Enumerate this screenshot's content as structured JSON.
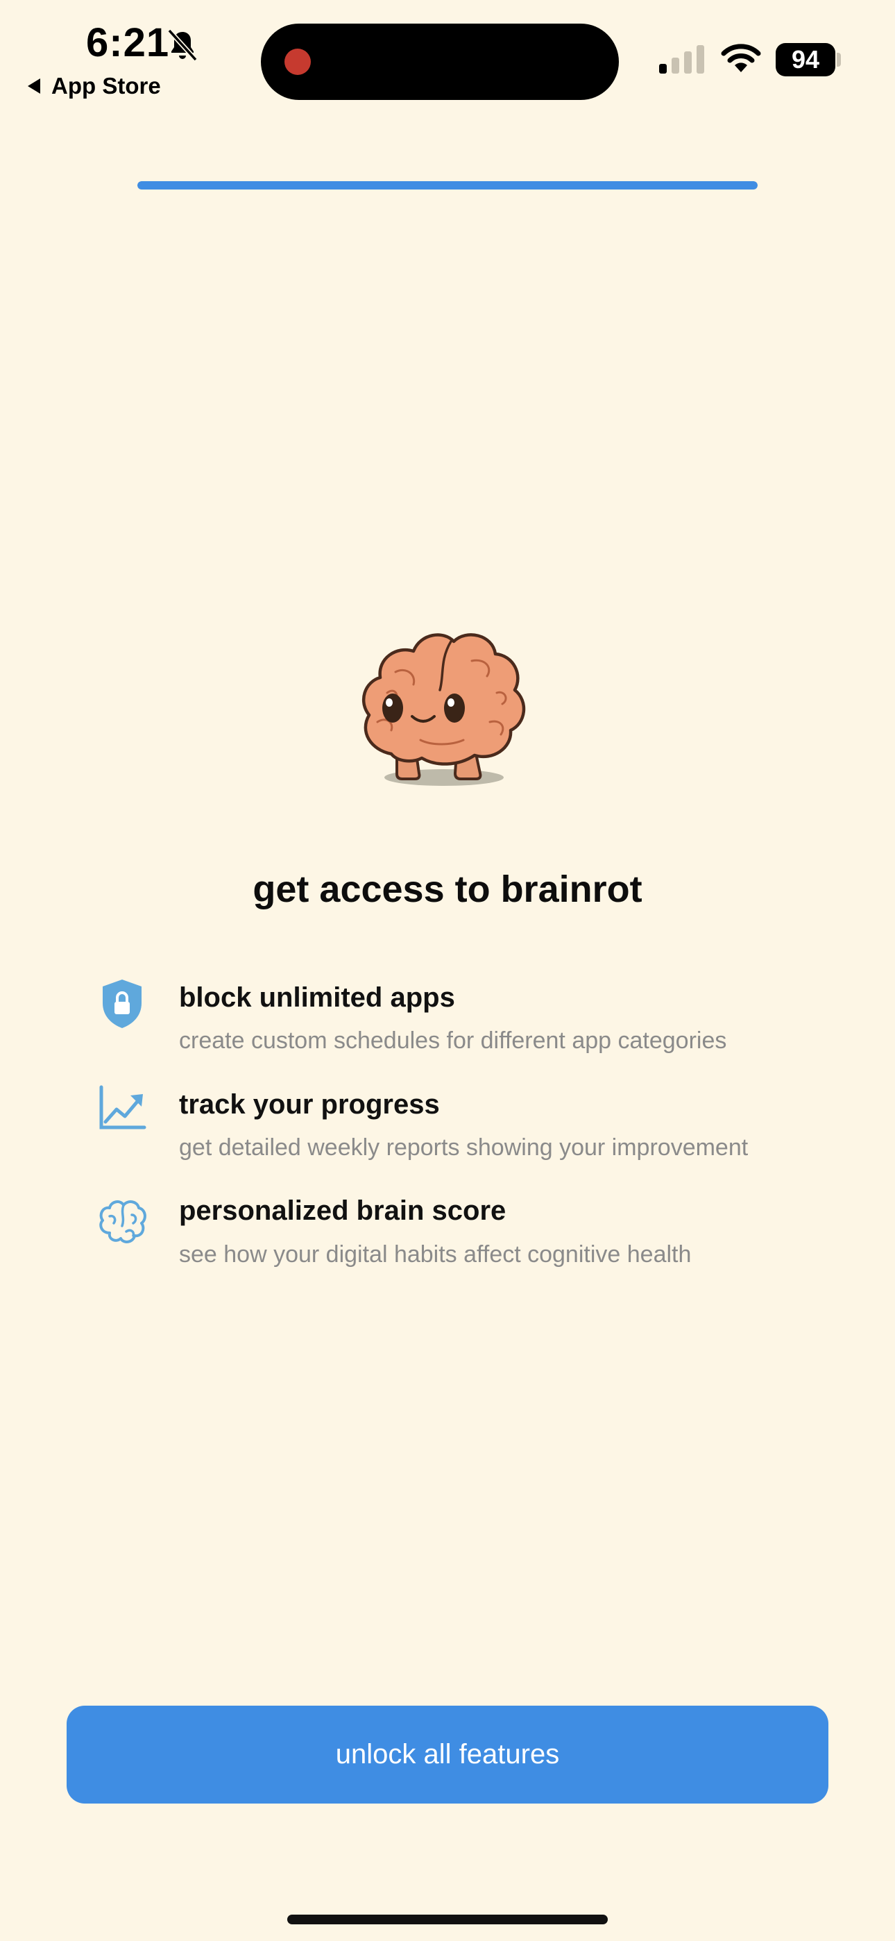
{
  "status_bar": {
    "time": "6:21",
    "back_label": "App Store",
    "battery": "94",
    "icons": [
      "bell-slash-icon",
      "cell-signal-icon",
      "wifi-icon",
      "battery-icon"
    ]
  },
  "onboarding": {
    "progress": 1.0
  },
  "hero": {
    "title": "get access to brainrot"
  },
  "features": [
    {
      "icon": "shield-lock-icon",
      "title": "block unlimited apps",
      "description": "create custom schedules for different app categories"
    },
    {
      "icon": "trending-chart-icon",
      "title": "track your progress",
      "description": "get detailed weekly reports showing your improvement"
    },
    {
      "icon": "brain-icon",
      "title": "personalized brain score",
      "description": "see how your digital habits affect cognitive health"
    }
  ],
  "cta": {
    "label": "unlock all features"
  },
  "colors": {
    "background": "#FDF6E5",
    "accent": "#3F8DE3",
    "icon": "#5FA8DC",
    "secondary_text": "#8A8A8A"
  }
}
